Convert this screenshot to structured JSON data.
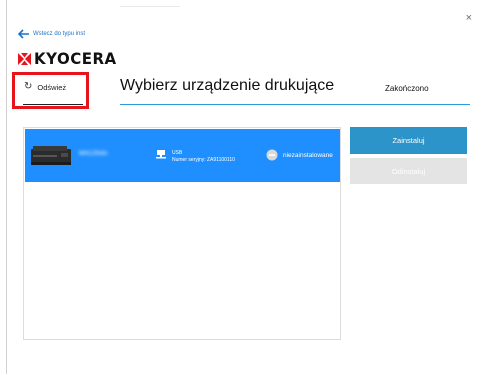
{
  "header": {
    "back_label": "Wstecz do typu inst",
    "logo_text": "KYOCERA",
    "brand_color": "#e8141b"
  },
  "toolbar": {
    "refresh_label": "Odśwież",
    "page_title": "Wybierz urządzenie drukujące",
    "done_label": "Zakończono"
  },
  "devices": [
    {
      "name": "M4125idn",
      "connection": "USB",
      "serial": "Numer seryjny: ZA91100110",
      "status": "niezainstalowane",
      "selected": true
    }
  ],
  "actions": {
    "install_label": "Zainstaluj",
    "uninstall_label": "Odinstaluj"
  },
  "colors": {
    "selection": "#1f8fff",
    "accent": "#2a9ad8",
    "install_button": "#2c94c8",
    "highlight_box": "#e8141b"
  },
  "icons": [
    "close-icon",
    "back-arrow-icon",
    "refresh-icon",
    "printer-icon",
    "usb-connection-icon",
    "minus-circle-icon"
  ]
}
